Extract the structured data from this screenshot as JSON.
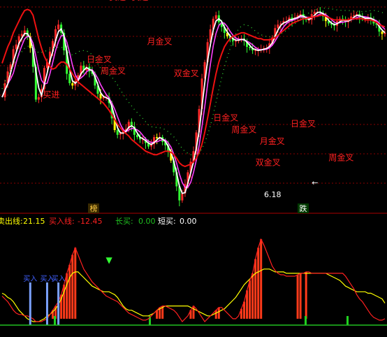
{
  "chart_data": [
    {
      "type": "line",
      "panel": "price",
      "grid": true,
      "x": [
        0,
        2,
        4,
        6,
        8,
        10,
        12,
        14,
        16,
        18,
        20,
        22,
        24,
        26,
        28,
        30,
        32,
        34,
        36,
        38,
        40,
        42,
        44,
        46,
        48,
        50,
        52,
        54,
        56,
        58,
        60,
        62,
        64,
        66,
        68,
        70,
        72,
        74,
        76,
        78,
        80,
        82,
        84,
        86,
        88,
        90,
        92,
        94,
        96,
        98,
        100,
        102,
        104,
        106,
        108,
        110,
        112,
        114,
        116,
        118,
        120,
        122,
        124,
        126,
        128,
        130,
        132,
        134,
        136,
        138,
        140,
        142,
        144,
        146,
        148,
        150,
        152,
        154,
        156,
        158,
        160,
        162,
        164,
        166,
        168,
        170,
        172,
        174,
        176,
        178,
        180,
        182,
        184,
        186,
        188,
        190,
        192,
        194,
        196,
        198,
        200,
        202,
        204,
        206,
        208,
        210,
        212,
        214,
        216,
        218,
        220,
        222,
        224,
        226,
        228,
        230,
        232,
        234,
        236,
        238,
        240,
        242,
        244,
        246,
        248,
        250,
        252,
        254,
        256,
        258,
        260,
        262,
        264,
        266,
        268,
        270,
        272
      ],
      "close": [
        330,
        342,
        352,
        358,
        371,
        375,
        382,
        384,
        387,
        382,
        372,
        356,
        328,
        330,
        337,
        355,
        360,
        369,
        378,
        388,
        392,
        385,
        370,
        350,
        342,
        340,
        344,
        349,
        357,
        353,
        356,
        352,
        350,
        340,
        333,
        329,
        330,
        330,
        325,
        312,
        302,
        298,
        299,
        301,
        303,
        309,
        305,
        298,
        296,
        294,
        294,
        291,
        288,
        290,
        296,
        295,
        296,
        292,
        289,
        284,
        276,
        266,
        254,
        242,
        248,
        256,
        266,
        275,
        284,
        300,
        320,
        346,
        360,
        377,
        388,
        397,
        400,
        394,
        390,
        385,
        382,
        380,
        378,
        378,
        380,
        380,
        378,
        373,
        372,
        370,
        370,
        370,
        371,
        372,
        372,
        376,
        381,
        389,
        392,
        393,
        395,
        395,
        398,
        396,
        398,
        400,
        401,
        397,
        396,
        396,
        401,
        403,
        403,
        402,
        399,
        395,
        393,
        392,
        391,
        395,
        397,
        395,
        394,
        396,
        399,
        400,
        401,
        398,
        397,
        397,
        398,
        397,
        393,
        392,
        386,
        384,
        385
      ],
      "series": [
        {
          "name": "",
          "values": [
            359,
            366,
            373,
            378,
            385,
            390,
            395,
            400,
            404,
            405,
            404,
            400,
            390,
            380,
            372,
            365,
            360,
            356,
            354,
            355,
            358,
            360,
            360,
            358,
            354,
            350,
            346,
            343,
            341,
            339,
            337,
            335,
            333,
            331,
            329,
            327,
            325,
            322,
            319,
            315,
            311,
            307,
            304,
            301,
            299,
            297,
            294,
            292,
            290,
            288,
            286,
            284,
            283,
            282,
            281,
            281,
            282,
            283,
            284,
            284,
            283,
            281,
            278,
            274,
            272,
            271,
            272,
            273,
            275,
            278,
            283,
            290,
            300,
            312,
            325,
            338,
            350,
            360,
            367,
            373,
            377,
            380,
            382,
            383,
            384,
            385,
            385,
            384,
            383,
            382,
            381,
            380,
            380,
            379,
            379,
            379,
            380,
            381,
            383,
            385,
            387,
            389,
            391,
            393,
            394,
            395,
            396,
            397,
            397,
            398,
            398,
            399,
            399,
            400,
            400,
            399,
            398,
            397,
            396,
            396,
            396,
            396,
            396,
            396,
            397,
            397,
            397,
            397,
            397,
            396,
            396,
            396,
            395,
            394,
            392,
            391,
            390
          ]
        }
      ],
      "ylim": [
        240,
        410
      ],
      "markers": [
        {
          "text": "买进",
          "x": 28
        },
        {
          "text": "卖进",
          "x": 75
        },
        {
          "text": "卖进",
          "x": 91
        }
      ],
      "tags": [
        "日金叉",
        "周金叉",
        "月金叉",
        "双金叉",
        "卖进"
      ],
      "low_label": "6.18",
      "bottom_tags": [
        "榜",
        "跌"
      ]
    },
    {
      "type": "line",
      "panel": "oscillator",
      "grid": false,
      "x": [
        0,
        2,
        4,
        6,
        8,
        10,
        12,
        14,
        16,
        18,
        20,
        22,
        24,
        26,
        28,
        30,
        32,
        34,
        36,
        38,
        40,
        42,
        44,
        46,
        48,
        50,
        52,
        54,
        56,
        58,
        60,
        62,
        64,
        66,
        68,
        70,
        72,
        74,
        76,
        78,
        80,
        82,
        84,
        86,
        88,
        90,
        92,
        94,
        96,
        98,
        100,
        102,
        104,
        106,
        108,
        110,
        112,
        114,
        116,
        118,
        120,
        122,
        124,
        126,
        128,
        130,
        132,
        134,
        136,
        138,
        140,
        142,
        144,
        146,
        148,
        150,
        152,
        154,
        156,
        158,
        160,
        162,
        164,
        166,
        168,
        170,
        172,
        174,
        176,
        178,
        180,
        182,
        184,
        186,
        188,
        190,
        192,
        194,
        196,
        198,
        200,
        202,
        204,
        206,
        208,
        210,
        212,
        214,
        216,
        218,
        220,
        222,
        224,
        226,
        228,
        230,
        232,
        234,
        236,
        238,
        240,
        242,
        244,
        246,
        248,
        250,
        252,
        254,
        256,
        258,
        260,
        262,
        264,
        266,
        268,
        270,
        272
      ],
      "legend": [
        {
          "label": "卖出线:",
          "value": "21.15",
          "color": "#ffff00"
        },
        {
          "label": "买入线:",
          "value": "-12.45",
          "color": "#ff2020"
        },
        {
          "label": "长买:",
          "value": "0.00",
          "color": "#20c020"
        },
        {
          "label": "短买:",
          "value": "0.00",
          "color": "#ffffff"
        }
      ],
      "series": [
        {
          "name": "卖出线",
          "color": "#ffff00",
          "values": [
            6,
            5,
            3,
            2,
            0,
            -3,
            -6,
            -8,
            -10,
            -12,
            -13,
            -14,
            -14,
            -14,
            -13,
            -12,
            -10,
            -9,
            -7,
            -5,
            -2,
            2,
            7,
            12,
            17,
            20,
            21,
            21,
            19,
            17,
            15,
            13,
            11,
            10,
            9,
            8,
            7,
            7,
            7,
            6,
            5,
            3,
            0,
            -3,
            -5,
            -6,
            -6,
            -7,
            -8,
            -9,
            -10,
            -10,
            -10,
            -9,
            -8,
            -6,
            -5,
            -4,
            -3,
            -3,
            -3,
            -3,
            -3,
            -3,
            -3,
            -3,
            -3,
            -4,
            -5,
            -6,
            -7,
            -8,
            -9,
            -10,
            -10,
            -9,
            -8,
            -7,
            -6,
            -5,
            -3,
            -1,
            1,
            3,
            6,
            9,
            12,
            14,
            16,
            18,
            20,
            21,
            22,
            23,
            23,
            23,
            22,
            21,
            21,
            21,
            21,
            20,
            20,
            20,
            20,
            20,
            20,
            20,
            20,
            20,
            20,
            20,
            20,
            20,
            20,
            20,
            19,
            18,
            17,
            16,
            15,
            13,
            11,
            10,
            9,
            8,
            7,
            7,
            7,
            7,
            6,
            6,
            5,
            4,
            3,
            2,
            -1
          ]
        },
        {
          "name": "买入线",
          "color": "#ff2020",
          "values": [
            4,
            2,
            0,
            -3,
            -6,
            -8,
            -9,
            -9,
            -10,
            -10,
            -11,
            -12,
            -14,
            -14,
            -14,
            -13,
            -12,
            -9,
            -6,
            -3,
            0,
            5,
            12,
            20,
            26,
            33,
            38,
            33,
            28,
            23,
            20,
            17,
            14,
            12,
            10,
            8,
            6,
            4,
            3,
            2,
            1,
            0,
            -2,
            -4,
            -6,
            -8,
            -9,
            -10,
            -11,
            -12,
            -13,
            -13,
            -12,
            -10,
            -8,
            -6,
            -4,
            -3,
            -3,
            -4,
            -5,
            -6,
            -8,
            -11,
            -14,
            -12,
            -10,
            -6,
            -3,
            -5,
            -8,
            -11,
            -14,
            -12,
            -10,
            -8,
            -6,
            -4,
            -4,
            -6,
            -8,
            -10,
            -12,
            -12,
            -10,
            -5,
            0,
            8,
            15,
            20,
            30,
            38,
            44,
            40,
            35,
            30,
            25,
            22,
            20,
            19,
            19,
            18,
            18,
            18,
            18,
            19,
            20,
            20,
            21,
            21,
            20,
            20,
            20,
            20,
            20,
            20,
            20,
            20,
            20,
            20,
            20,
            20,
            18,
            15,
            12,
            9,
            5,
            2,
            0,
            -3,
            -6,
            -9,
            -11,
            -12,
            -13,
            -13,
            -12
          ]
        }
      ],
      "signals": [
        {
          "text": "买入",
          "x": 20
        },
        {
          "text": "买入",
          "x": 32
        },
        {
          "text": "买入",
          "x": 40
        }
      ],
      "ylim": [
        -15,
        50
      ]
    }
  ]
}
